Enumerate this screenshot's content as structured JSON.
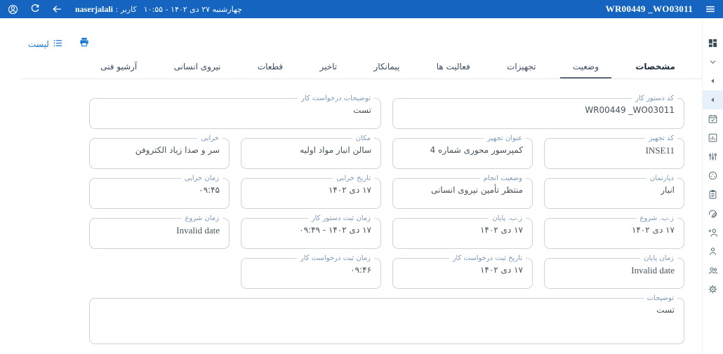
{
  "topbar": {
    "work_order_code": "WR00449 _WO03011",
    "user_prefix": "کاربر : ",
    "user_name": "naserjalali",
    "datetime": "چهارشنبه ۲۷ دی ۱۴۰۲ - ۱۰:۵۵"
  },
  "toolbar": {
    "list_label": "لیست"
  },
  "colors": {
    "topbar": "#1565c0",
    "accent": "#1976d2",
    "label": "#7e9ab8",
    "active_item_bg": "#e7f1fb"
  },
  "tabs": [
    {
      "label": "مشخصات",
      "selected": true
    },
    {
      "label": "وضعیت",
      "indicated": true
    },
    {
      "label": "تجهیزات"
    },
    {
      "label": "فعالیت ها"
    },
    {
      "label": "پیمانکار"
    },
    {
      "label": "تاخیر"
    },
    {
      "label": "قطعات"
    },
    {
      "label": "نیروی انسانی"
    },
    {
      "label": "آرشیو فنی"
    }
  ],
  "form": {
    "fields": [
      {
        "label": "کد دستور کار",
        "value": "WR00449 _WO03011"
      },
      {
        "label": "توضیحات درخواست کار",
        "value": "تست"
      },
      {
        "label": "کد تجهیز",
        "value": "INSE11"
      },
      {
        "label": "عنوان تجهیز",
        "value": "کمپرسور محوری شماره 4"
      },
      {
        "label": "مکان",
        "value": "سالن انبار مواد اولیه"
      },
      {
        "label": "خرابی",
        "value": "سر و صدا زیاد الکتروفن"
      },
      {
        "label": "دپارتمان",
        "value": "انبار"
      },
      {
        "label": "وضعیت انجام",
        "value": "منتظر تأمین نیروی انسانی"
      },
      {
        "label": "تاریخ خرابی",
        "value": "۱۷ دی ۱۴۰۲"
      },
      {
        "label": "زمان خرابی",
        "value": "۰۹:۴۵"
      },
      {
        "label": "ز.ب. شروع",
        "value": "۱۷ دی ۱۴۰۲"
      },
      {
        "label": "ز.ب. پایان",
        "value": "۱۷ دی ۱۴۰۲"
      },
      {
        "label": "زمان ثبت دستور کار",
        "value": "۱۷ دی ۱۴۰۲ - ۰۹:۴۹"
      },
      {
        "label": "زمان شروع",
        "value": "Invalid date"
      },
      {
        "label": "زمان پایان",
        "value": "Invalid date"
      },
      {
        "label": "تاریخ ثبت درخواست کار",
        "value": "۱۷ دی ۱۴۰۲"
      },
      {
        "label": "زمان ثبت درخواست کار",
        "value": "۰۹:۴۶"
      }
    ],
    "notes": {
      "label": "توضیحات",
      "value": "تست"
    }
  },
  "sidebar_icons": [
    "dashboard-icon",
    "chevron-down-icon",
    "collapse-left-icon",
    "collapse-left-active-icon",
    "calendar-check-icon",
    "bar-chart-icon",
    "sliders-icon",
    "gauge-icon",
    "clipboard-icon",
    "edit-icon",
    "person-add-icon",
    "person-icon",
    "people-icon",
    "settings-gear-icon"
  ]
}
